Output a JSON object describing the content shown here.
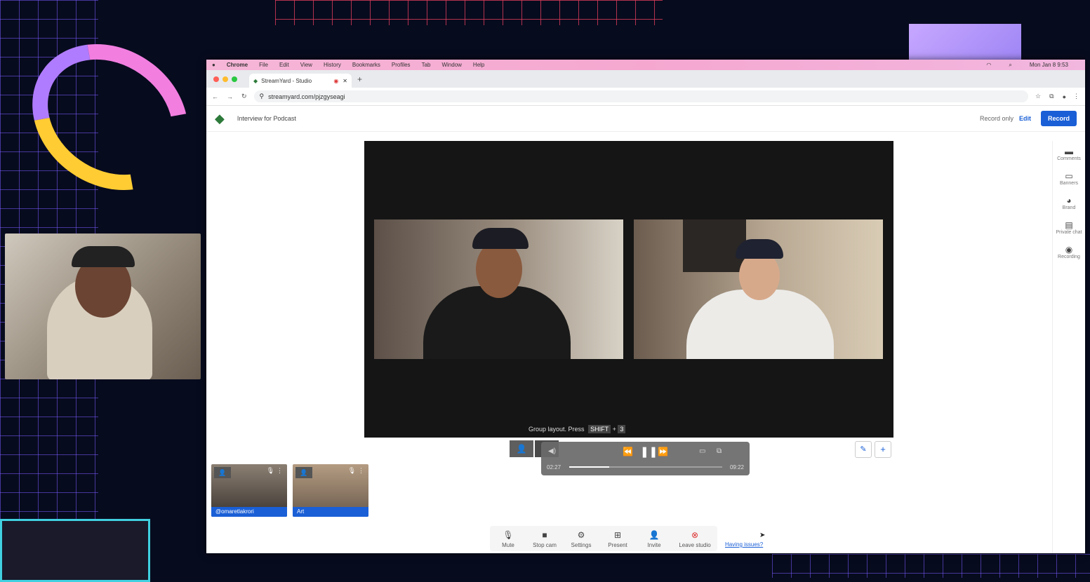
{
  "menubar": {
    "apple": "",
    "app": "Chrome",
    "items": [
      "File",
      "Edit",
      "View",
      "History",
      "Bookmarks",
      "Profiles",
      "Tab",
      "Window",
      "Help"
    ],
    "datetime": "Mon Jan 8 9:53"
  },
  "tab": {
    "title": "StreamYard - Studio"
  },
  "address": {
    "url": "streamyard.com/pjzgyseagi"
  },
  "header": {
    "title": "Interview for Podcast",
    "record_only": "Record only",
    "edit": "Edit",
    "record": "Record"
  },
  "stage": {
    "hint_text": "Group layout. Press",
    "hint_key1": "SHIFT",
    "hint_plus": "+",
    "hint_key2": "3"
  },
  "player": {
    "current": "02:27",
    "total": "09:22",
    "progress": 0.26
  },
  "sidebar": {
    "items": [
      "Comments",
      "Banners",
      "Brand",
      "Private chat",
      "Recording"
    ]
  },
  "participants": [
    "@omaretlakrori",
    "Art"
  ],
  "toolbar": {
    "mute": "Mute",
    "stop_cam": "Stop cam",
    "settings": "Settings",
    "present": "Present",
    "invite": "Invite",
    "leave": "Leave studio",
    "issues": "Having issues?"
  }
}
